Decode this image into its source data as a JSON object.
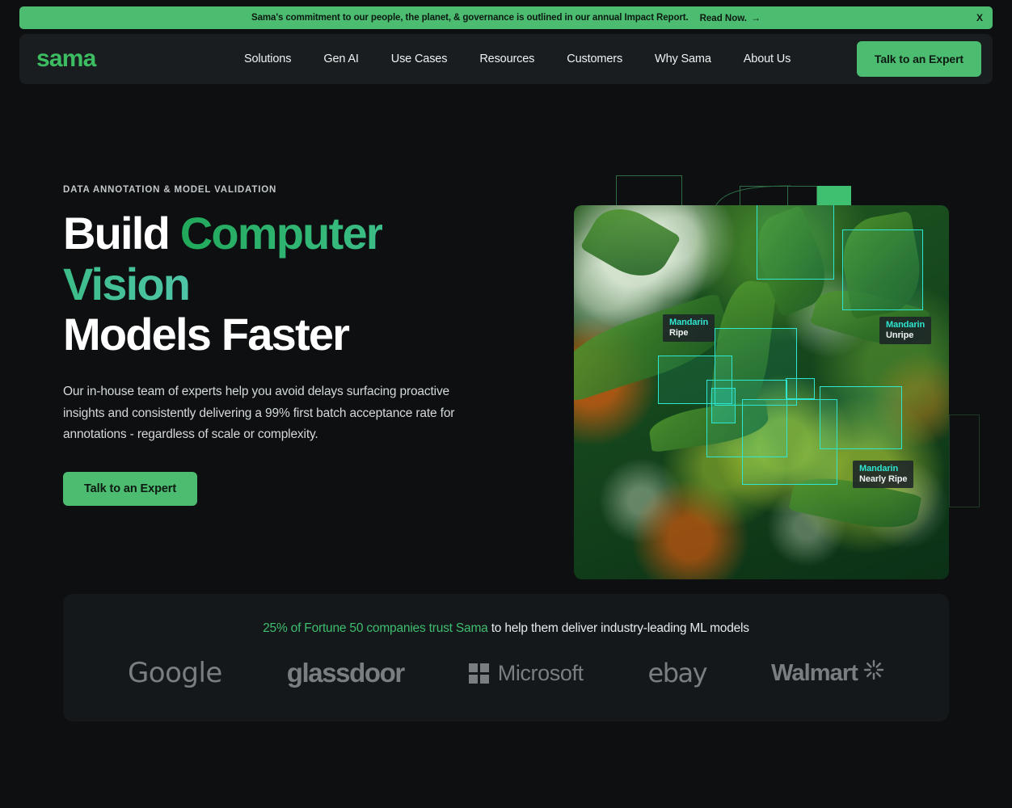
{
  "banner": {
    "text": "Sama's commitment to our people, the planet, & governance is outlined in our annual Impact Report.",
    "link_label": "Read Now.",
    "arrow": "→",
    "close_label": "X",
    "bg_color": "#4cbc70"
  },
  "nav": {
    "logo": "sama",
    "links": [
      {
        "label": "Solutions"
      },
      {
        "label": "Gen AI"
      },
      {
        "label": "Use Cases"
      },
      {
        "label": "Resources"
      },
      {
        "label": "Customers"
      },
      {
        "label": "Why Sama"
      },
      {
        "label": "About Us"
      }
    ],
    "cta_label": "Talk to an Expert",
    "accent_color": "#4cbc70"
  },
  "hero": {
    "eyebrow": "DATA ANNOTATION & MODEL VALIDATION",
    "headline_part1": "Build ",
    "headline_accent": "Computer Vision",
    "headline_part2": "Models Faster",
    "body": "Our in-house team of experts help you avoid delays surfacing proactive insights and consistently delivering a 99% first batch acceptance rate for annotations - regardless of scale or complexity.",
    "cta_label": "Talk to an Expert",
    "accent_color": "#34b97a"
  },
  "hero_image": {
    "alt": "Mandarin orange tree with object-detection bounding boxes",
    "box_color": "#2fe6d0",
    "annotations": [
      {
        "class": "Mandarin",
        "state": "Ripe"
      },
      {
        "class": "Mandarin",
        "state": "Unripe"
      },
      {
        "class": "Mandarin",
        "state": "Nearly Ripe"
      }
    ]
  },
  "trust": {
    "highlight": "25% of Fortune 50 companies trust Sama",
    "rest": " to help them deliver industry-leading ML models",
    "highlight_color": "#3fbd6f",
    "logos": [
      {
        "name": "Google"
      },
      {
        "name": "glassdoor"
      },
      {
        "name": "Microsoft"
      },
      {
        "name": "ebay"
      },
      {
        "name": "Walmart"
      }
    ]
  }
}
